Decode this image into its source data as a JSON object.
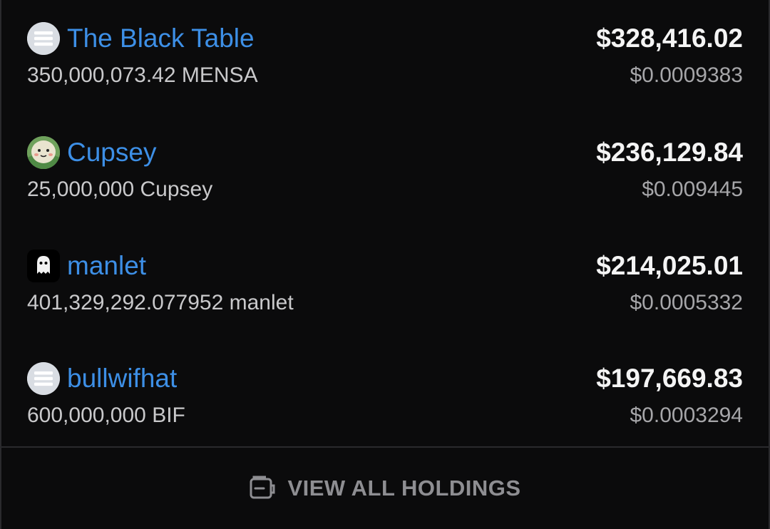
{
  "holdings": [
    {
      "name": "The Black Table",
      "amount": "350,000,073.42",
      "symbol": "MENSA",
      "value": "$328,416.02",
      "price": "$0.0009383",
      "icon": "solana-stripes-icon"
    },
    {
      "name": "Cupsey",
      "amount": "25,000,000",
      "symbol": "Cupsey",
      "value": "$236,129.84",
      "price": "$0.009445",
      "icon": "cupsey-mascot-icon"
    },
    {
      "name": "manlet",
      "amount": "401,329,292.077952",
      "symbol": "manlet",
      "value": "$214,025.01",
      "price": "$0.0005332",
      "icon": "manlet-ghost-icon"
    },
    {
      "name": "bullwifhat",
      "amount": "600,000,000",
      "symbol": "BIF",
      "value": "$197,669.83",
      "price": "$0.0003294",
      "icon": "solana-stripes-icon"
    }
  ],
  "footer": {
    "label": "VIEW ALL HOLDINGS",
    "icon": "wallet-icon"
  },
  "colors": {
    "background": "#0b0b0c",
    "link": "#3d8fe6",
    "value": "#f4f4f4",
    "muted": "#a6a6a9",
    "divider": "#2a2a2d"
  }
}
